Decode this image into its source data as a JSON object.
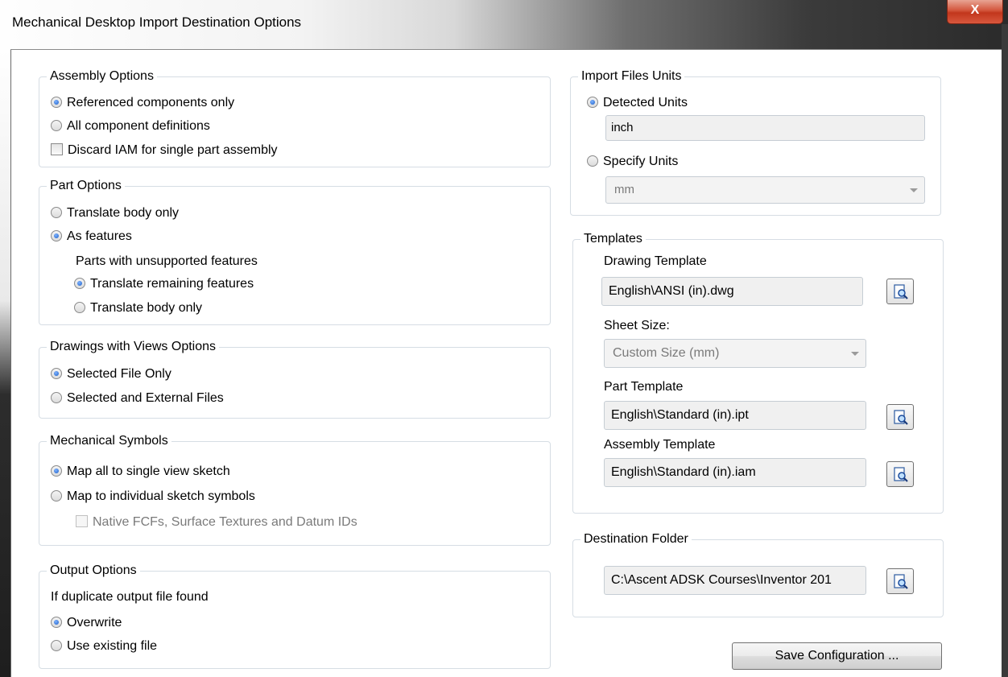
{
  "window": {
    "title": "Mechanical Desktop Import Destination Options",
    "close_label": "X"
  },
  "assembly": {
    "legend": "Assembly Options",
    "referenced": "Referenced components only",
    "all_defs": "All component definitions",
    "discard_iam": "Discard IAM for single part assembly"
  },
  "part": {
    "legend": "Part Options",
    "translate_body": "Translate body only",
    "as_features": "As features",
    "unsupported_label": "Parts with unsupported features",
    "translate_remaining": "Translate remaining features",
    "translate_body_sub": "Translate body only"
  },
  "drawings": {
    "legend": "Drawings with Views Options",
    "selected_only": "Selected File Only",
    "selected_external": "Selected and External Files"
  },
  "symbols": {
    "legend": "Mechanical Symbols",
    "map_single": "Map all to single view sketch",
    "map_individual": "Map to individual sketch symbols",
    "native_fcf": "Native FCFs, Surface Textures and Datum IDs"
  },
  "output": {
    "legend": "Output Options",
    "duplicate_label": "If duplicate output file found",
    "overwrite": "Overwrite",
    "use_existing": "Use existing file"
  },
  "units": {
    "legend": "Import Files Units",
    "detected": "Detected Units",
    "detected_value": "inch",
    "specify": "Specify Units",
    "specify_value": "mm"
  },
  "templates": {
    "legend": "Templates",
    "drawing_label": "Drawing Template",
    "drawing_value": "English\\ANSI (in).dwg",
    "sheet_label": "Sheet Size:",
    "sheet_value": "Custom Size (mm)",
    "part_label": "Part Template",
    "part_value": "English\\Standard (in).ipt",
    "assembly_label": "Assembly Template",
    "assembly_value": "English\\Standard (in).iam"
  },
  "destination": {
    "legend": "Destination Folder",
    "value": "C:\\Ascent ADSK Courses\\Inventor 201"
  },
  "save_button": "Save Configuration ...",
  "icons": {
    "close": "close-icon",
    "browse": "browse-folder-icon",
    "radio": "radio-icon",
    "checkbox": "checkbox-icon"
  }
}
